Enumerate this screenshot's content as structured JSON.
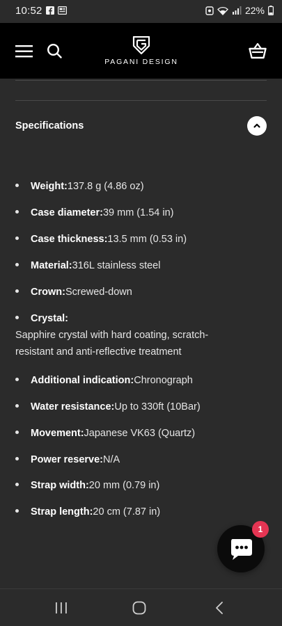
{
  "status_bar": {
    "time": "10:52",
    "battery": "22%"
  },
  "header": {
    "brand": "PAGANI DESIGN"
  },
  "section": {
    "title": "Specifications"
  },
  "specs": [
    {
      "label": "Weight:",
      "value": "137.8 g (4.86 oz)"
    },
    {
      "label": "Case diameter:",
      "value": "39 mm (1.54 in)"
    },
    {
      "label": "Case thickness:",
      "value": "13.5 mm (0.53 in)"
    },
    {
      "label": "Material:",
      "value": "316L stainless steel"
    },
    {
      "label": "Crown:",
      "value": "Screwed-down"
    },
    {
      "label": "Crystal:",
      "value": "",
      "description": "Sapphire crystal with hard coating, scratch-resistant and anti-reflective treatment"
    },
    {
      "label": "Additional indication:",
      "value": "Chronograph"
    },
    {
      "label": "Water resistance:",
      "value": "Up to 330ft (10Bar)"
    },
    {
      "label": "Movement:",
      "value": "Japanese VK63 (Quartz)"
    },
    {
      "label": "Power reserve:",
      "value": "N/A"
    },
    {
      "label": "Strap width:",
      "value": "20 mm (0.79 in)"
    },
    {
      "label": "Strap length:",
      "value": "20 cm (7.87 in)"
    }
  ],
  "chat": {
    "badge_count": "1"
  },
  "colors": {
    "background": "#2b2b2b",
    "header": "#000000",
    "badge": "#e53553"
  }
}
